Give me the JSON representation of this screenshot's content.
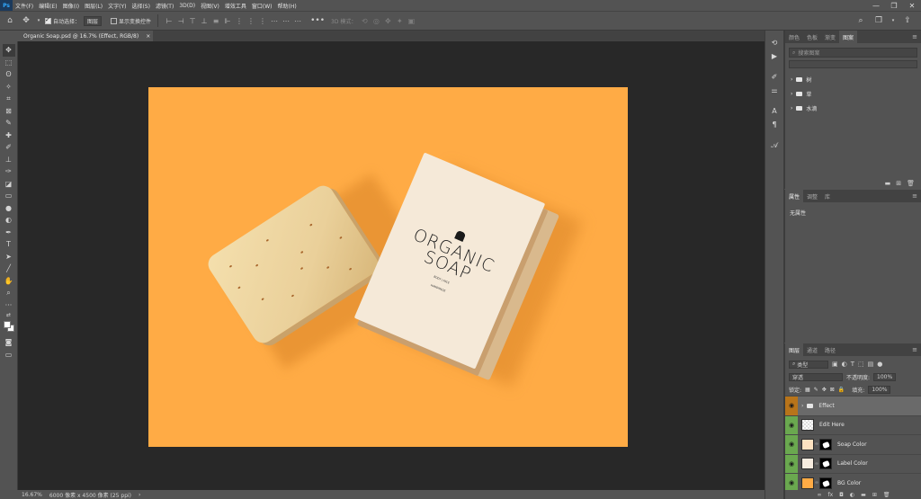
{
  "app": {
    "logo": "Ps"
  },
  "menu": [
    "文件(F)",
    "编辑(E)",
    "图像(I)",
    "图层(L)",
    "文字(Y)",
    "选择(S)",
    "滤镜(T)",
    "3D(D)",
    "视图(V)",
    "增效工具",
    "窗口(W)",
    "帮助(H)"
  ],
  "window_controls": {
    "minimize": "—",
    "restore": "❐",
    "close": "✕"
  },
  "options_bar": {
    "auto_select_label": "自动选择：",
    "auto_select_target": "图层",
    "show_transform_label": "显示变换控件",
    "mode_3d_label": "3D 模式："
  },
  "document": {
    "tab_title": "Organic  Soap.psd @ 16.7% (Effect, RGB/8)",
    "close_glyph": "×"
  },
  "artwork": {
    "title_line1": "ORGANIC",
    "title_line2": "SOAP",
    "sub_line1": "BODY | FACE",
    "sub_line2": "HANDMADE"
  },
  "status_bar": {
    "zoom": "16.67%",
    "doc_size": "6000 像素 x 4500 像素 (25 ppi)",
    "arrow": "›"
  },
  "panel_top": {
    "tabs": [
      "颜色",
      "色板",
      "渐变",
      "图案"
    ],
    "active_tab": 3,
    "search_placeholder": "搜索图案",
    "folders": [
      "树",
      "草",
      "水滴"
    ]
  },
  "panel_props": {
    "tabs": [
      "属性",
      "调整",
      "库"
    ],
    "active_tab": 0,
    "empty_text": "无属性"
  },
  "layers_panel": {
    "tabs": [
      "图层",
      "通道",
      "路径"
    ],
    "active_tab": 0,
    "filter_kind": "类型",
    "blend_mode": "穿透",
    "opacity_label": "不透明度:",
    "opacity_value": "100%",
    "lock_label": "锁定:",
    "fill_label": "填充:",
    "fill_value": "100%",
    "layers": [
      {
        "name": "Effect",
        "type": "group",
        "selected": true
      },
      {
        "name": "Edit Here",
        "type": "smart",
        "selected": false
      },
      {
        "name": "Soap Color",
        "type": "adjust",
        "thumb_color": "#fde2c0",
        "selected": false
      },
      {
        "name": "Label Color",
        "type": "adjust",
        "thumb_color": "#f7ecdf",
        "selected": false
      },
      {
        "name": "BG Color",
        "type": "adjust",
        "thumb_color": "#ffab45",
        "selected": false
      }
    ]
  },
  "colors": {
    "artboard": "#ffab45",
    "eye_column": "#6aa84f",
    "eye_column_group": "#b8741a"
  }
}
